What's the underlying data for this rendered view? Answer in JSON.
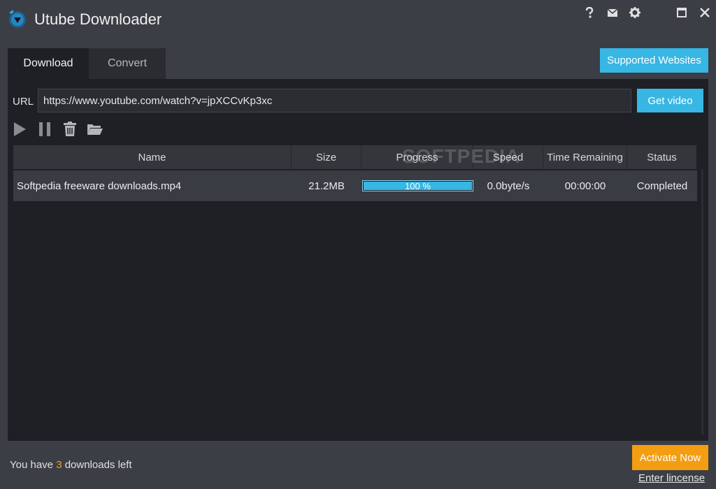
{
  "window": {
    "title": "Utube Downloader",
    "controls": [
      "help-icon",
      "mail-icon",
      "gear-icon",
      "maximize-icon",
      "close-icon"
    ]
  },
  "tabs": [
    {
      "label": "Download",
      "active": true
    },
    {
      "label": "Convert",
      "active": false
    }
  ],
  "supported_websites_label": "Supported Websites",
  "url_bar": {
    "label": "URL",
    "value": "https://www.youtube.com/watch?v=jpXCCvKp3xc",
    "button_label": "Get video"
  },
  "toolbar": [
    "play-icon",
    "pause-icon",
    "trash-icon",
    "folder-open-icon"
  ],
  "table": {
    "columns": [
      "Name",
      "Size",
      "Progress",
      "Speed",
      "Time Remaining",
      "Status"
    ],
    "rows": [
      {
        "name": "Softpedia freeware downloads.mp4",
        "size": "21.2MB",
        "progress": 100,
        "progress_label": "100 %",
        "speed": "0.0byte/s",
        "time_remaining": "00:00:00",
        "status": "Completed"
      }
    ]
  },
  "watermark": "SOFTPEDIA",
  "footer": {
    "prefix": "You have ",
    "count": "3",
    "suffix": " downloads left",
    "activate_label": "Activate Now",
    "license_label": "Enter lincense"
  },
  "colors": {
    "accent": "#38b6e4",
    "activate": "#f29d12",
    "background": "#3b3e45",
    "panel": "#1f2025"
  }
}
